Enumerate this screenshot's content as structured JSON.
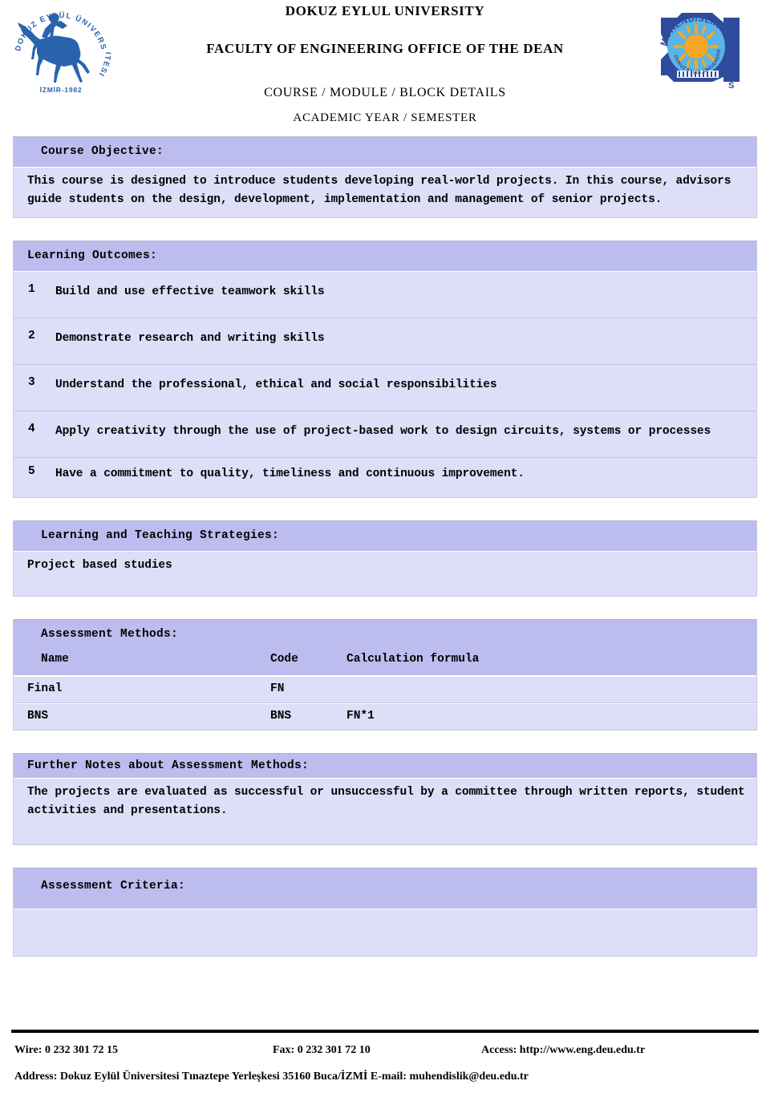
{
  "header": {
    "university": "DOKUZ EYLUL UNIVERSITY",
    "faculty": "FACULTY OF ENGINEERING OFFICE OF THE DEAN",
    "document_title": "COURSE / MODULE / BLOCK DETAILS",
    "academic_period": "ACADEMIC YEAR / SEMESTER",
    "left_logo": {
      "name": "dokuz-eylul-university-seal",
      "ring_text": "DOKUZ EYLÜL ÜNİVERSİTESİ",
      "year_text": "İZMİR-1982",
      "color": "#2a63ad"
    },
    "right_logo": {
      "name": "engineering-faculty-logo",
      "arc_text": "MÜHENDİSLİK",
      "inner_text": "DOKUZ EYLÜL ÜNİVERSİTESİ",
      "side_text": "FAKÜLTESİ",
      "colors": {
        "outline": "#2e4b9c",
        "disc": "#5ab4e5",
        "sun": "#f5a623"
      }
    }
  },
  "course_objective": {
    "heading": "Course Objective:",
    "text": "This course is designed to introduce students developing real-world projects. In this course, advisors guide students on the design, development, implementation and management of senior projects."
  },
  "learning_outcomes": {
    "heading": "Learning Outcomes:",
    "items": [
      {
        "no": "1",
        "text": "Build and use effective teamwork skills"
      },
      {
        "no": "2",
        "text": "Demonstrate research and writing skills"
      },
      {
        "no": "3",
        "text": "Understand the professional, ethical and social responsibilities"
      },
      {
        "no": "4",
        "text": "Apply creativity through the use of project-based work to design circuits, systems or processes"
      },
      {
        "no": "5",
        "text": "Have a commitment to quality, timeliness and continuous improvement."
      }
    ]
  },
  "learning_teaching_strategies": {
    "heading": "Learning and Teaching Strategies:",
    "text": "Project based studies"
  },
  "assessment_methods": {
    "heading": "Assessment Methods:",
    "columns": {
      "name": "Name",
      "code": "Code",
      "formula": "Calculation formula"
    },
    "rows": [
      {
        "name": "Final",
        "code": "FN",
        "formula": ""
      },
      {
        "name": "BNS",
        "code": "BNS",
        "formula": "FN*1"
      }
    ]
  },
  "further_notes": {
    "heading": "Further Notes about Assessment Methods:",
    "text": "The projects are evaluated as successful or unsuccessful by a committee through written reports, student activities and presentations."
  },
  "assessment_criteria": {
    "heading": "Assessment Criteria:",
    "text": ""
  },
  "footer": {
    "wire": "Wire: 0 232 301 72 15",
    "fax": "Fax: 0 232 301 72 10",
    "access": "Access: http://www.eng.deu.edu.tr",
    "address": "Address: Dokuz Eylül Üniversitesi Tınaztepe Yerleşkesi 35160 Buca/İZMİ  E-mail: muhendislik@deu.edu.tr"
  },
  "colors": {
    "panel_header": "#bcbcee",
    "panel_body": "#dedef8",
    "border": "#c3c3e6"
  }
}
